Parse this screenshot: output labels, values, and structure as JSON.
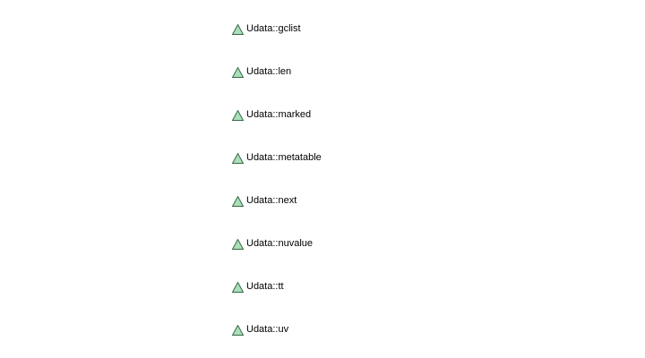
{
  "members": [
    {
      "label": "Udata::gclist",
      "icon": "triangle-icon"
    },
    {
      "label": "Udata::len",
      "icon": "triangle-icon"
    },
    {
      "label": "Udata::marked",
      "icon": "triangle-icon"
    },
    {
      "label": "Udata::metatable",
      "icon": "triangle-icon"
    },
    {
      "label": "Udata::next",
      "icon": "triangle-icon"
    },
    {
      "label": "Udata::nuvalue",
      "icon": "triangle-icon"
    },
    {
      "label": "Udata::tt",
      "icon": "triangle-icon"
    },
    {
      "label": "Udata::uv",
      "icon": "triangle-icon"
    }
  ],
  "colors": {
    "icon_fill": "#a9dfb9",
    "icon_stroke": "#3a6a48",
    "text": "#000000",
    "background": "#ffffff"
  }
}
